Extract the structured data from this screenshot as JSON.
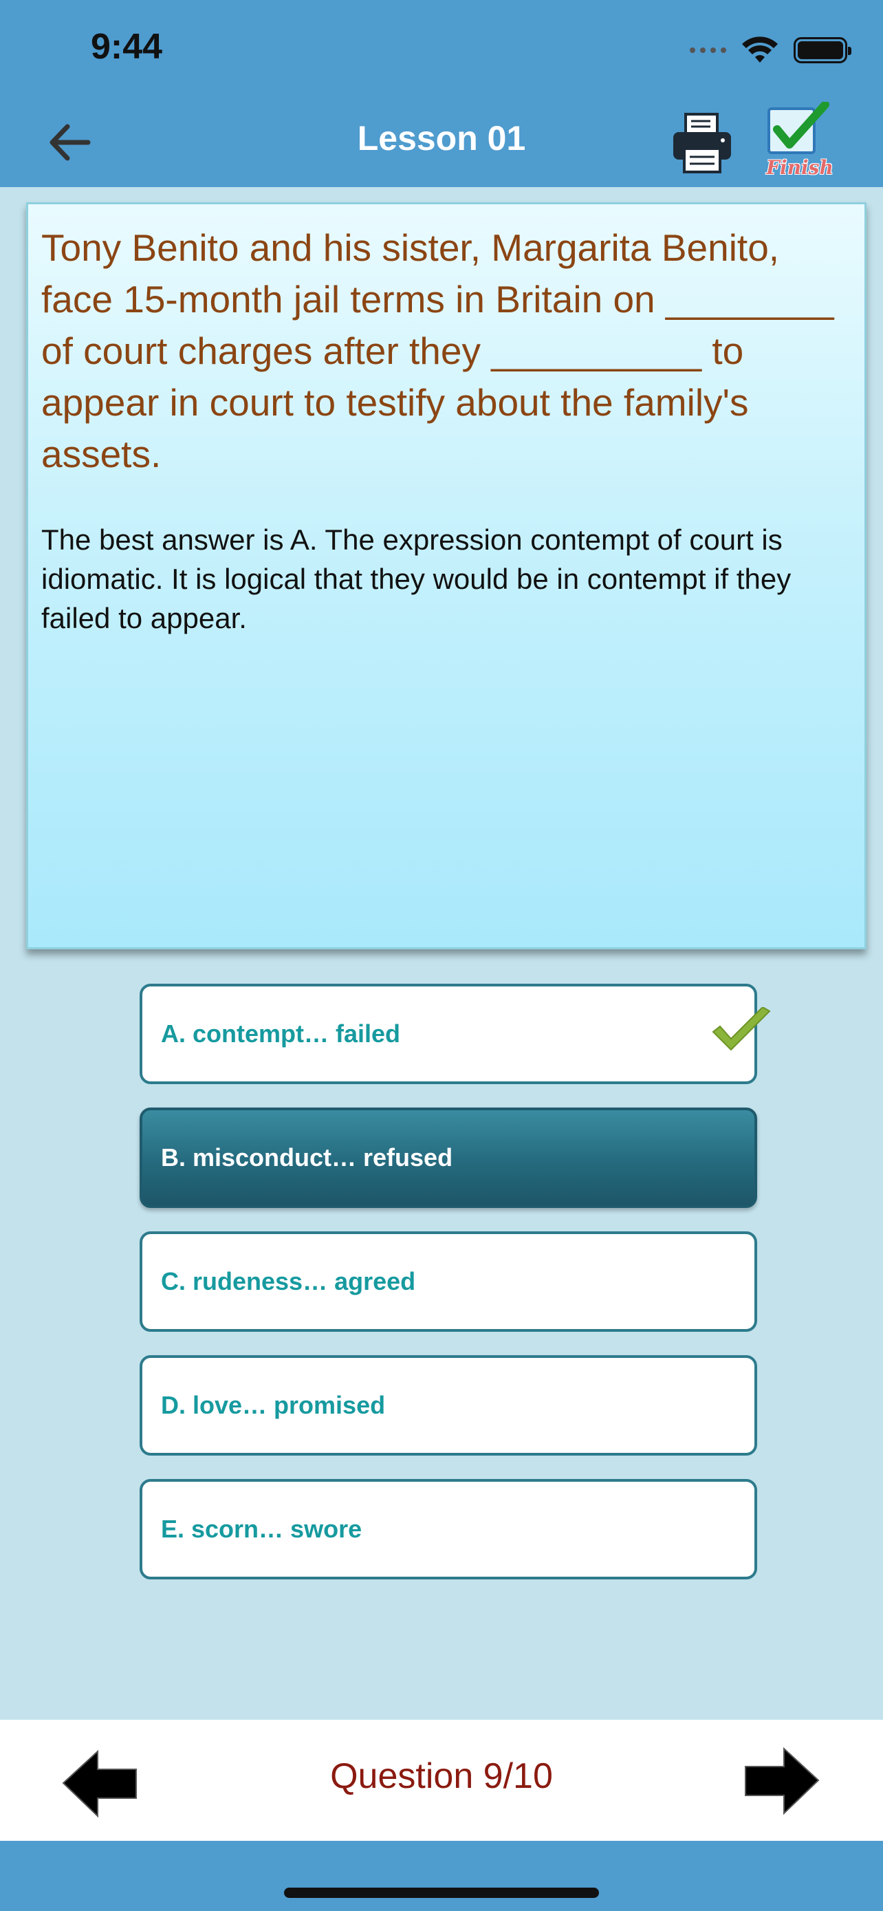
{
  "status_bar": {
    "time": "9:44"
  },
  "header": {
    "title": "Lesson 01",
    "back_icon": "arrow-left-icon",
    "print_icon": "printer-icon",
    "finish_label": "Finish",
    "finish_icon": "checkbox-check-icon"
  },
  "question": {
    "text": "Tony Benito and his sister, Margarita Benito, face 15-month jail terms in Britain on ________ of court charges after they __________ to appear in court to testify about the family's assets.",
    "explanation": "The best answer is A. The expression contempt of court is idiomatic. It is logical that they would be in contempt if they failed to appear."
  },
  "answers": [
    {
      "label": "A. contempt… failed",
      "state": "correct"
    },
    {
      "label": "B. misconduct… refused",
      "state": "selected"
    },
    {
      "label": "C. rudeness… agreed",
      "state": "normal"
    },
    {
      "label": "D. love… promised",
      "state": "normal"
    },
    {
      "label": "E. scorn… swore",
      "state": "normal"
    }
  ],
  "footer": {
    "counter": "Question 9/10",
    "prev_icon": "big-arrow-left-icon",
    "next_icon": "big-arrow-right-icon"
  },
  "colors": {
    "header_bg": "#4f9ccf",
    "question_text": "#8b4513",
    "answer_text": "#169a9f",
    "selected_answer_bg": "#256a7e",
    "counter_text": "#8b1a0f"
  }
}
